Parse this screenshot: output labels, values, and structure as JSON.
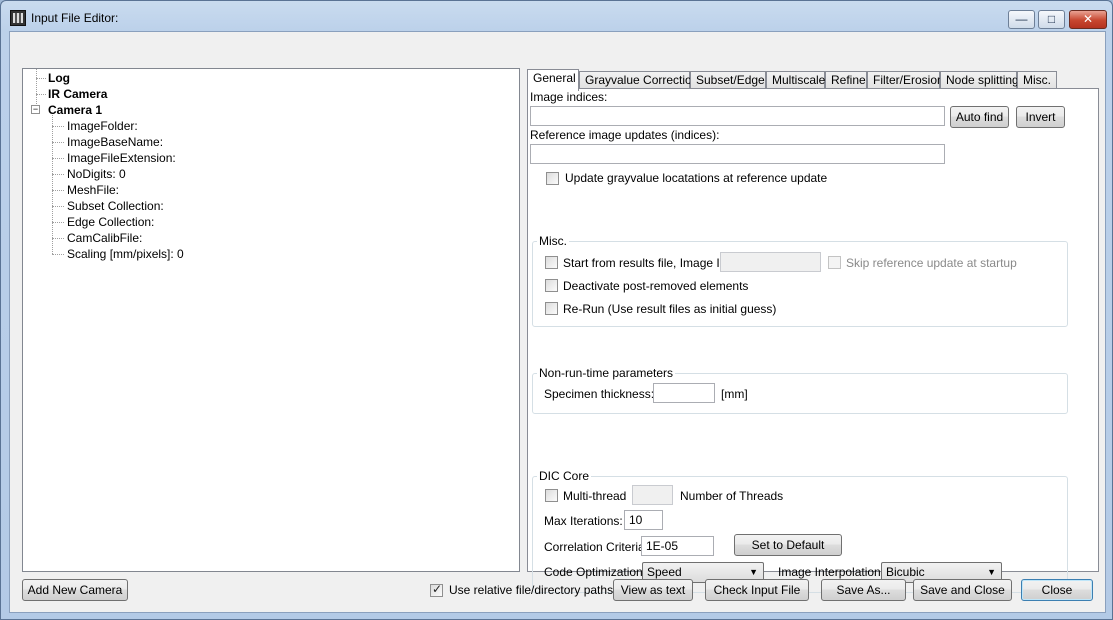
{
  "window": {
    "title": "Input File Editor:",
    "controls": {
      "minimize": "—",
      "maximize": "□",
      "close": "✕"
    }
  },
  "tree": {
    "root_items": [
      {
        "label": "Log",
        "bold": true
      },
      {
        "label": "IR Camera",
        "bold": true
      },
      {
        "label": "Camera 1",
        "bold": true,
        "expander": "−"
      }
    ],
    "camera_children": [
      "ImageFolder:",
      "ImageBaseName:",
      "ImageFileExtension:",
      "NoDigits: 0",
      "MeshFile:",
      "Subset Collection:",
      "Edge Collection:",
      "CamCalibFile:",
      "Scaling [mm/pixels]: 0"
    ]
  },
  "tabs": [
    "General",
    "Grayvalue Correction",
    "Subset/Edge",
    "Multiscale",
    "Refine",
    "Filter/Erosion",
    "Node splitting",
    "Misc."
  ],
  "general": {
    "image_indices_label": "Image indices:",
    "image_indices_value": "",
    "auto_find": "Auto find",
    "invert": "Invert",
    "ref_updates_label": "Reference image updates (indices):",
    "ref_updates_value": "",
    "update_grayvalue": "Update grayvalue locatations at reference update",
    "misc_group": {
      "title": "Misc.",
      "start_from_results": "Start from results file, Image Id:",
      "image_id_value": "",
      "skip_reference": "Skip reference update at startup",
      "deactivate": "Deactivate post-removed elements",
      "rerun": "Re-Run (Use result files as initial guess)"
    },
    "nonrun_group": {
      "title": "Non-run-time parameters",
      "specimen_label": "Specimen thickness:",
      "specimen_value": "",
      "unit": "[mm]"
    },
    "dic_group": {
      "title": "DIC Core",
      "multithread": "Multi-thread",
      "threads_value": "",
      "threads_label": "Number of Threads",
      "max_iter_label": "Max Iterations:",
      "max_iter_value": "10",
      "corr_label": "Correlation Criteria:",
      "corr_value": "1E-05",
      "set_default": "Set to Default",
      "code_opt_label": "Code Optimization:",
      "code_opt_value": "Speed",
      "interp_label": "Image Interpolation:",
      "interp_value": "Bicubic"
    }
  },
  "footer": {
    "add_camera": "Add New Camera",
    "use_relative": "Use relative file/directory paths",
    "use_relative_checked": true,
    "view_as_text": "View as text",
    "check_input": "Check Input File",
    "save_as": "Save As...",
    "save_close": "Save and Close",
    "close": "Close"
  }
}
